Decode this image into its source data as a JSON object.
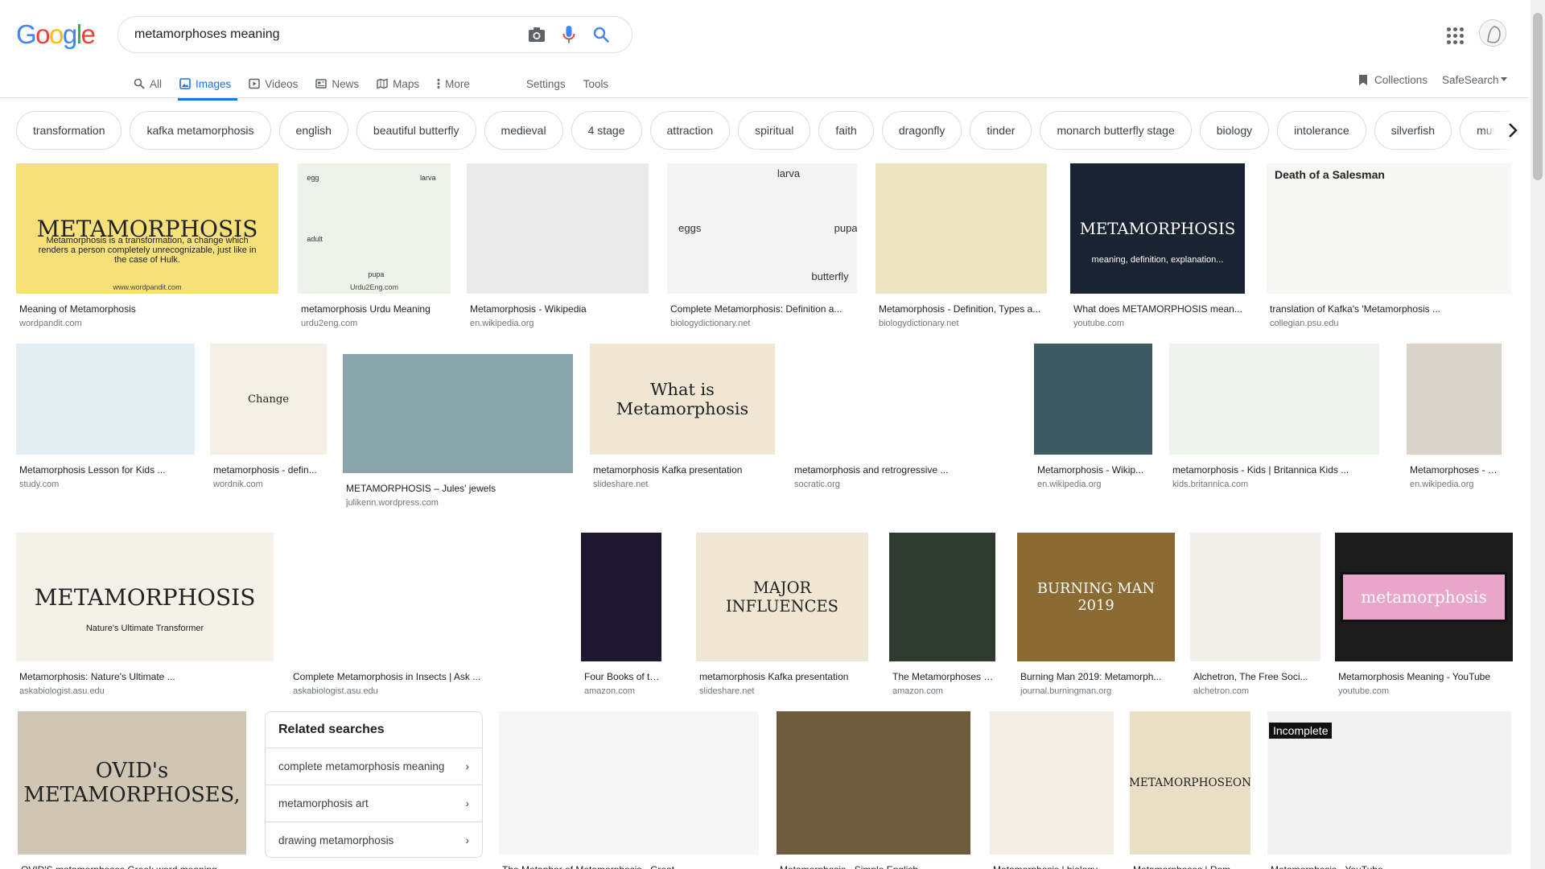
{
  "header": {
    "logo": "Google",
    "query": "metamorphoses meaning",
    "icons": {
      "camera": "camera-icon",
      "mic": "mic-icon",
      "search": "search-icon",
      "apps": "apps-icon"
    }
  },
  "tabs": {
    "all": "All",
    "images": "Images",
    "videos": "Videos",
    "news": "News",
    "maps": "Maps",
    "more": "More",
    "settings": "Settings",
    "tools": "Tools",
    "collections": "Collections",
    "safesearch": "SafeSearch"
  },
  "chips": [
    "transformation",
    "kafka metamorphosis",
    "english",
    "beautiful butterfly",
    "medieval",
    "4 stage",
    "attraction",
    "spiritual",
    "faith",
    "dragonfly",
    "tinder",
    "monarch butterfly stage",
    "biology",
    "intolerance",
    "silverfish",
    "mutation"
  ],
  "results": [
    {
      "caption": "Meaning of Metamorphosis",
      "source": "wordpandit.com",
      "thumb": "METAMORPHOSIS",
      "thumb_sub": "Metamorphosis is a transformation, a change which renders a person completely unrecognizable, just like in the case of Hulk.",
      "thumb_foot": "www.wordpandit.com"
    },
    {
      "caption": "metamorphosis Urdu Meaning",
      "source": "urdu2eng.com",
      "thumb_labels": [
        "egg",
        "larva",
        "adult",
        "pupa"
      ],
      "thumb_foot": "Urdu2Eng.com"
    },
    {
      "caption": "Metamorphosis - Wikipedia",
      "source": "en.wikipedia.org"
    },
    {
      "caption": "Complete Metamorphosis: Definition a...",
      "source": "biologydictionary.net",
      "thumb_labels": [
        "larva",
        "eggs",
        "pupa",
        "butterfly"
      ]
    },
    {
      "caption": "Metamorphosis - Definition, Types a...",
      "source": "biologydictionary.net"
    },
    {
      "caption": "What does METAMORPHOSIS mean...",
      "source": "youtube.com",
      "thumb": "METAMORPHOSIS",
      "thumb_sub": "meaning, definition, explanation..."
    },
    {
      "caption": "translation of Kafka's 'Metamorphosis ...",
      "source": "collegian.psu.edu",
      "thumb": "Death of a Salesman"
    },
    {
      "caption": "Metamorphosis Lesson for Kids ...",
      "source": "study.com"
    },
    {
      "caption": "metamorphosis - defin...",
      "source": "wordnik.com",
      "thumb": "Change"
    },
    {
      "caption": "METAMORPHOSIS – Jules' jewels",
      "source": "julikenn.wordpress.com"
    },
    {
      "caption": "metamorphosis Kafka presentation",
      "source": "slideshare.net",
      "thumb": "What is Metamorphosis"
    },
    {
      "caption": "metamorphosis and retrogressive ...",
      "source": "socratic.org"
    },
    {
      "caption": "Metamorphosis - Wikip...",
      "source": "en.wikipedia.org"
    },
    {
      "caption": "metamorphosis - Kids | Britannica Kids ...",
      "source": "kids.britannica.com"
    },
    {
      "caption": "Metamorphoses - Wiki...",
      "source": "en.wikipedia.org"
    },
    {
      "caption": "Metamorphosis: Nature's Ultimate ...",
      "source": "askabiologist.asu.edu",
      "thumb": "METAMORPHOSIS",
      "thumb_sub": "Nature's Ultimate Transformer"
    },
    {
      "caption": "Complete Metamorphosis in Insects | Ask ...",
      "source": "askabiologist.asu.edu"
    },
    {
      "caption": "Four Books of the Met...",
      "source": "amazon.com"
    },
    {
      "caption": "metamorphosis Kafka presentation",
      "source": "slideshare.net",
      "thumb": "MAJOR INFLUENCES"
    },
    {
      "caption": "The Metamorphoses o...",
      "source": "amazon.com"
    },
    {
      "caption": "Burning Man 2019: Metamorph...",
      "source": "journal.burningman.org",
      "thumb": "BURNING MAN 2019"
    },
    {
      "caption": "Alchetron, The Free Soci...",
      "source": "alchetron.com"
    },
    {
      "caption": "Metamorphosis Meaning - YouTube",
      "source": "youtube.com",
      "thumb": "metamorphosis"
    },
    {
      "caption": "OVID'S metamorphoses Greek word meaning",
      "source": "",
      "thumb": "OVID's METAMORPHOSES,"
    },
    {
      "caption": "The Metaphor of Metamorphosis - Great ...",
      "source": ""
    },
    {
      "caption": "Metamorphosis - Simple English ...",
      "source": ""
    },
    {
      "caption": "Metamorphosis | biology ...",
      "source": ""
    },
    {
      "caption": "Metamorphoses | Rom...",
      "source": "",
      "thumb": "METAMORPHOSEON"
    },
    {
      "caption": "Metamorphosis - YouTube",
      "source": "",
      "thumb": "Incomplete"
    }
  ],
  "related": {
    "title": "Related searches",
    "items": [
      "complete metamorphosis meaning",
      "metamorphosis art",
      "drawing metamorphosis"
    ]
  },
  "colors": {
    "blue": "#4285F4",
    "red": "#EA4335",
    "yellow": "#FBBC05",
    "green": "#34A853",
    "active_tab": "#1a73e8"
  }
}
